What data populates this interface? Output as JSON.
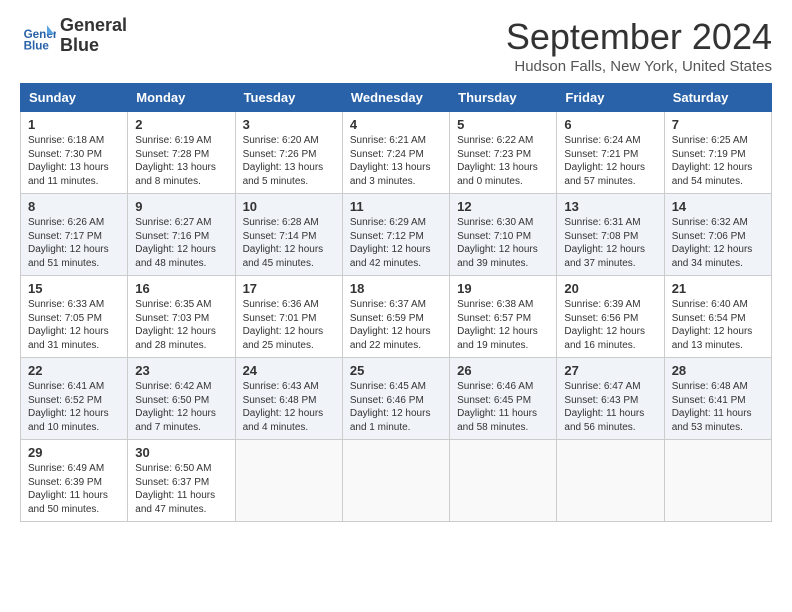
{
  "header": {
    "logo_line1": "General",
    "logo_line2": "Blue",
    "month": "September 2024",
    "location": "Hudson Falls, New York, United States"
  },
  "days": [
    "Sunday",
    "Monday",
    "Tuesday",
    "Wednesday",
    "Thursday",
    "Friday",
    "Saturday"
  ],
  "weeks": [
    [
      {
        "num": "1",
        "sunrise": "6:18 AM",
        "sunset": "7:30 PM",
        "daylight": "13 hours and 11 minutes."
      },
      {
        "num": "2",
        "sunrise": "6:19 AM",
        "sunset": "7:28 PM",
        "daylight": "13 hours and 8 minutes."
      },
      {
        "num": "3",
        "sunrise": "6:20 AM",
        "sunset": "7:26 PM",
        "daylight": "13 hours and 5 minutes."
      },
      {
        "num": "4",
        "sunrise": "6:21 AM",
        "sunset": "7:24 PM",
        "daylight": "13 hours and 3 minutes."
      },
      {
        "num": "5",
        "sunrise": "6:22 AM",
        "sunset": "7:23 PM",
        "daylight": "13 hours and 0 minutes."
      },
      {
        "num": "6",
        "sunrise": "6:24 AM",
        "sunset": "7:21 PM",
        "daylight": "12 hours and 57 minutes."
      },
      {
        "num": "7",
        "sunrise": "6:25 AM",
        "sunset": "7:19 PM",
        "daylight": "12 hours and 54 minutes."
      }
    ],
    [
      {
        "num": "8",
        "sunrise": "6:26 AM",
        "sunset": "7:17 PM",
        "daylight": "12 hours and 51 minutes."
      },
      {
        "num": "9",
        "sunrise": "6:27 AM",
        "sunset": "7:16 PM",
        "daylight": "12 hours and 48 minutes."
      },
      {
        "num": "10",
        "sunrise": "6:28 AM",
        "sunset": "7:14 PM",
        "daylight": "12 hours and 45 minutes."
      },
      {
        "num": "11",
        "sunrise": "6:29 AM",
        "sunset": "7:12 PM",
        "daylight": "12 hours and 42 minutes."
      },
      {
        "num": "12",
        "sunrise": "6:30 AM",
        "sunset": "7:10 PM",
        "daylight": "12 hours and 39 minutes."
      },
      {
        "num": "13",
        "sunrise": "6:31 AM",
        "sunset": "7:08 PM",
        "daylight": "12 hours and 37 minutes."
      },
      {
        "num": "14",
        "sunrise": "6:32 AM",
        "sunset": "7:06 PM",
        "daylight": "12 hours and 34 minutes."
      }
    ],
    [
      {
        "num": "15",
        "sunrise": "6:33 AM",
        "sunset": "7:05 PM",
        "daylight": "12 hours and 31 minutes."
      },
      {
        "num": "16",
        "sunrise": "6:35 AM",
        "sunset": "7:03 PM",
        "daylight": "12 hours and 28 minutes."
      },
      {
        "num": "17",
        "sunrise": "6:36 AM",
        "sunset": "7:01 PM",
        "daylight": "12 hours and 25 minutes."
      },
      {
        "num": "18",
        "sunrise": "6:37 AM",
        "sunset": "6:59 PM",
        "daylight": "12 hours and 22 minutes."
      },
      {
        "num": "19",
        "sunrise": "6:38 AM",
        "sunset": "6:57 PM",
        "daylight": "12 hours and 19 minutes."
      },
      {
        "num": "20",
        "sunrise": "6:39 AM",
        "sunset": "6:56 PM",
        "daylight": "12 hours and 16 minutes."
      },
      {
        "num": "21",
        "sunrise": "6:40 AM",
        "sunset": "6:54 PM",
        "daylight": "12 hours and 13 minutes."
      }
    ],
    [
      {
        "num": "22",
        "sunrise": "6:41 AM",
        "sunset": "6:52 PM",
        "daylight": "12 hours and 10 minutes."
      },
      {
        "num": "23",
        "sunrise": "6:42 AM",
        "sunset": "6:50 PM",
        "daylight": "12 hours and 7 minutes."
      },
      {
        "num": "24",
        "sunrise": "6:43 AM",
        "sunset": "6:48 PM",
        "daylight": "12 hours and 4 minutes."
      },
      {
        "num": "25",
        "sunrise": "6:45 AM",
        "sunset": "6:46 PM",
        "daylight": "12 hours and 1 minute."
      },
      {
        "num": "26",
        "sunrise": "6:46 AM",
        "sunset": "6:45 PM",
        "daylight": "11 hours and 58 minutes."
      },
      {
        "num": "27",
        "sunrise": "6:47 AM",
        "sunset": "6:43 PM",
        "daylight": "11 hours and 56 minutes."
      },
      {
        "num": "28",
        "sunrise": "6:48 AM",
        "sunset": "6:41 PM",
        "daylight": "11 hours and 53 minutes."
      }
    ],
    [
      {
        "num": "29",
        "sunrise": "6:49 AM",
        "sunset": "6:39 PM",
        "daylight": "11 hours and 50 minutes."
      },
      {
        "num": "30",
        "sunrise": "6:50 AM",
        "sunset": "6:37 PM",
        "daylight": "11 hours and 47 minutes."
      },
      null,
      null,
      null,
      null,
      null
    ]
  ]
}
